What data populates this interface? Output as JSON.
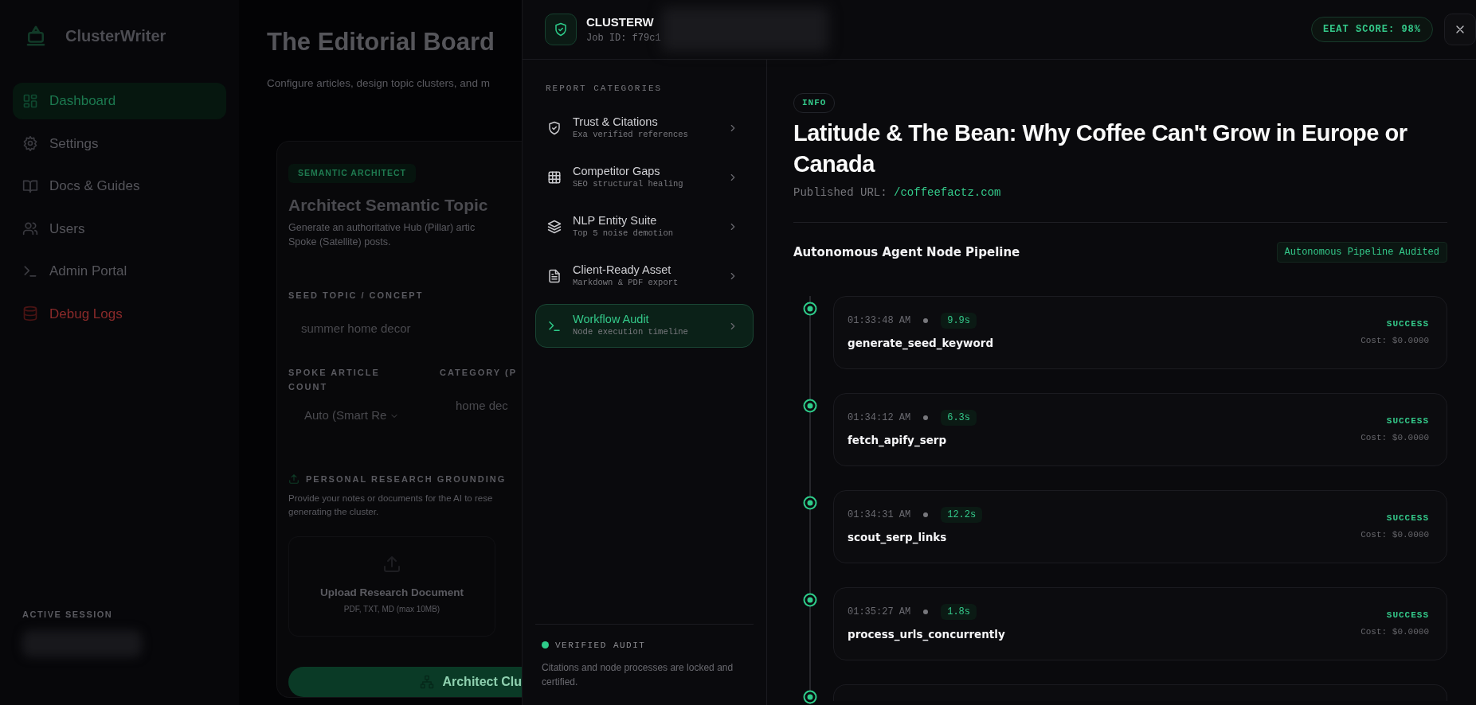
{
  "background_app": {
    "logo": "ClusterWriter",
    "nav": [
      {
        "label": "Dashboard",
        "kind": "dashboard",
        "selected": true,
        "danger": false
      },
      {
        "label": "Settings",
        "kind": "settings",
        "selected": false,
        "danger": false
      },
      {
        "label": "Docs & Guides",
        "kind": "docs",
        "selected": false,
        "danger": false
      },
      {
        "label": "Users",
        "kind": "users",
        "selected": false,
        "danger": false
      },
      {
        "label": "Admin Portal",
        "kind": "terminal",
        "selected": false,
        "danger": false
      },
      {
        "label": "Debug Logs",
        "kind": "database",
        "selected": false,
        "danger": true
      }
    ],
    "session": {
      "label": "ACTIVE SESSION",
      "redacted": true
    },
    "page_title": "The Editorial Board",
    "page_subtitle": "Configure articles, design topic clusters, and m",
    "card": {
      "badge": "SEMANTIC ARCHITECT",
      "title": "Architect Semantic Topic",
      "description_lines": [
        "Generate an authoritative Hub (Pillar) artic",
        "Spoke (Satellite) posts."
      ],
      "seed_label": "SEED TOPIC / CONCEPT",
      "seed_value": "summer home decor",
      "count_label_lines": [
        "SPOKE ARTICLE",
        "COUNT"
      ],
      "count_value": "Auto (Smart Re",
      "category_label": "CATEGORY (P",
      "category_value": "home dec",
      "research_label": "PERSONAL RESEARCH GROUNDING",
      "research_text_lines": [
        "Provide your notes or documents for the AI to rese",
        "generating the cluster."
      ],
      "upload_title": "Upload Research Document",
      "upload_hint": "PDF, TXT, MD (max 10MB)",
      "submit": "Architect Clu"
    }
  },
  "modal": {
    "header": {
      "title": "CLUSTERW",
      "job_id": "Job ID: f79c1",
      "redacted": true,
      "score": "EEAT SCORE: 98%"
    },
    "categories": {
      "heading": "REPORT CATEGORIES",
      "items": [
        {
          "title": "Trust & Citations",
          "subtitle": "Exa verified references",
          "kind": "shield",
          "selected": false
        },
        {
          "title": "Competitor Gaps",
          "subtitle": "SEO structural healing",
          "kind": "grid",
          "selected": false
        },
        {
          "title": "NLP Entity Suite",
          "subtitle": "Top 5 noise demotion",
          "kind": "layers",
          "selected": false
        },
        {
          "title": "Client-Ready Asset",
          "subtitle": "Markdown & PDF export",
          "kind": "file",
          "selected": false
        },
        {
          "title": "Workflow Audit",
          "subtitle": "Node execution timeline",
          "kind": "terminal",
          "selected": true
        }
      ],
      "footer": {
        "status": "VERIFIED AUDIT",
        "text": "Citations and node processes are locked and certified."
      }
    },
    "article": {
      "badge": "INFO",
      "title": "Latitude & The Bean: Why Coffee Can't Grow in Europe or Canada",
      "url_label": "Published URL:",
      "url": "/coffeefactz.com"
    },
    "pipeline": {
      "title": "Autonomous Agent Node Pipeline",
      "badge": "Autonomous Pipeline Audited",
      "partial_node": true,
      "nodes": [
        {
          "time": "01:33:48 AM",
          "duration": "9.9s",
          "name": "generate_seed_keyword",
          "status": "SUCCESS",
          "cost": "Cost: $0.0000"
        },
        {
          "time": "01:34:12 AM",
          "duration": "6.3s",
          "name": "fetch_apify_serp",
          "status": "SUCCESS",
          "cost": "Cost: $0.0000"
        },
        {
          "time": "01:34:31 AM",
          "duration": "12.2s",
          "name": "scout_serp_links",
          "status": "SUCCESS",
          "cost": "Cost: $0.0000"
        },
        {
          "time": "01:35:27 AM",
          "duration": "1.8s",
          "name": "process_urls_concurrently",
          "status": "SUCCESS",
          "cost": "Cost: $0.0000"
        }
      ]
    }
  }
}
